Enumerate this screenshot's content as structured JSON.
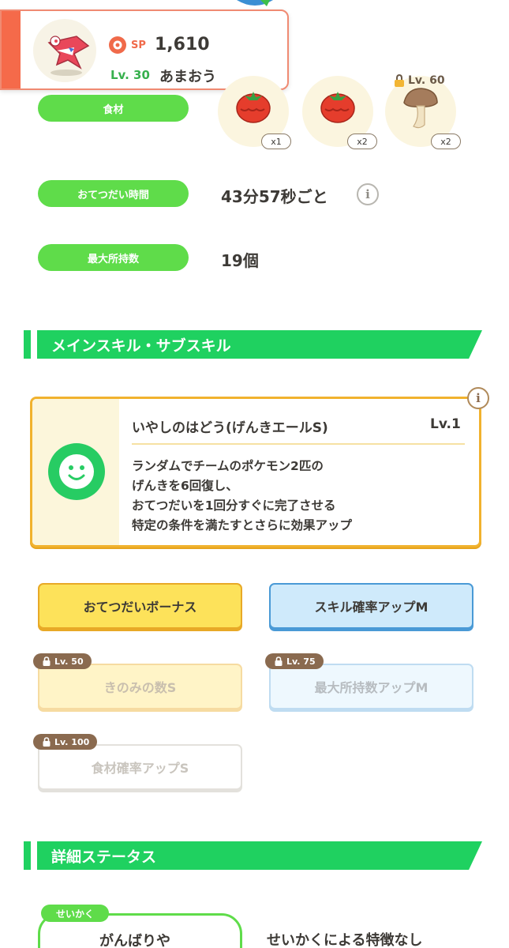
{
  "header": {
    "sp_label": "SP",
    "sp_value": "1,610",
    "level": "Lv. 30",
    "name": "あまおう"
  },
  "ingredients": {
    "label": "食材",
    "items": [
      {
        "icon": "tomato-icon",
        "qty": "x1",
        "locked": false
      },
      {
        "icon": "tomato-icon",
        "qty": "x2",
        "locked": false
      },
      {
        "icon": "mushroom-icon",
        "qty": "x2",
        "locked": true,
        "lock_level": "Lv. 60"
      }
    ]
  },
  "help_time": {
    "label": "おてつだい時間",
    "value": "43分57秒ごと"
  },
  "max_carry": {
    "label": "最大所持数",
    "value": "19個"
  },
  "skills_section": {
    "title": "メインスキル・サブスキル"
  },
  "main_skill": {
    "name": "いやしのはどう(げんきエールS)",
    "level": "Lv.1",
    "description": [
      "ランダムでチームのポケモン2匹の",
      "げんきを6回復し、",
      "おてつだいを1回分すぐに完了させる",
      "特定の条件を満たすとさらに効果アップ"
    ]
  },
  "sub_skills": [
    {
      "name": "おてつだいボーナス",
      "unlocked": true
    },
    {
      "name": "スキル確率アップM",
      "unlocked": true
    },
    {
      "name": "きのみの数S",
      "unlocked": false,
      "lock_level": "Lv. 50"
    },
    {
      "name": "最大所持数アップM",
      "unlocked": false,
      "lock_level": "Lv. 75"
    },
    {
      "name": "食材確率アップS",
      "unlocked": false,
      "lock_level": "Lv. 100"
    }
  ],
  "details_section": {
    "title": "詳細ステータス"
  },
  "nature": {
    "tag": "せいかく",
    "name": "がんばりや",
    "effect": "せいかくによる特徴なし"
  },
  "colors": {
    "accent_green": "#1fd160",
    "pill_green": "#5fdc4a",
    "sp_orange": "#f06a4a",
    "skill_gold": "#f1b22e",
    "skill_blue": "#4a9ad6"
  }
}
